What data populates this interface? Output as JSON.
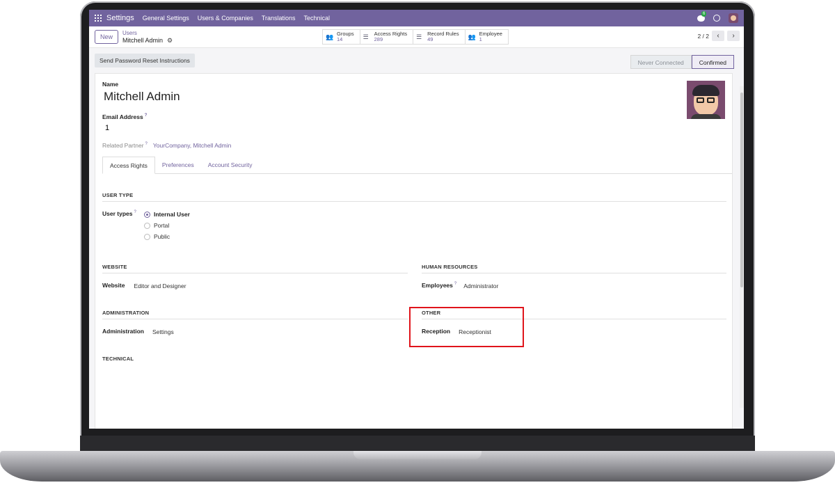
{
  "navbar": {
    "brand": "Settings",
    "menu": [
      "General Settings",
      "Users & Companies",
      "Translations",
      "Technical"
    ],
    "chat_count": "6"
  },
  "control": {
    "new_label": "New",
    "breadcrumb_parent": "Users",
    "breadcrumb_current": "Mitchell Admin",
    "smart_buttons": [
      {
        "label": "Groups",
        "value": "14"
      },
      {
        "label": "Access Rights",
        "value": "289"
      },
      {
        "label": "Record Rules",
        "value": "49"
      },
      {
        "label": "Employee",
        "value": "1"
      }
    ],
    "pager": "2 / 2"
  },
  "statusbar": {
    "reset_label": "Send Password Reset Instructions",
    "stages": [
      "Never Connected",
      "Confirmed"
    ],
    "active_stage": "Confirmed"
  },
  "form": {
    "name_label": "Name",
    "name_value": "Mitchell Admin",
    "email_label": "Email Address",
    "email_value": "1",
    "partner_label": "Related Partner",
    "partner_value": "YourCompany, Mitchell Admin",
    "tabs": [
      "Access Rights",
      "Preferences",
      "Account Security"
    ],
    "user_type_title": "USER TYPE",
    "user_types_label": "User types",
    "user_types": [
      "Internal User",
      "Portal",
      "Public"
    ],
    "website_title": "WEBSITE",
    "website_label": "Website",
    "website_value": "Editor and Designer",
    "hr_title": "HUMAN RESOURCES",
    "employees_label": "Employees",
    "employees_value": "Administrator",
    "admin_title": "ADMINISTRATION",
    "admin_label": "Administration",
    "admin_value": "Settings",
    "other_title": "OTHER",
    "reception_label": "Reception",
    "reception_value": "Receptionist",
    "technical_title": "TECHNICAL"
  }
}
